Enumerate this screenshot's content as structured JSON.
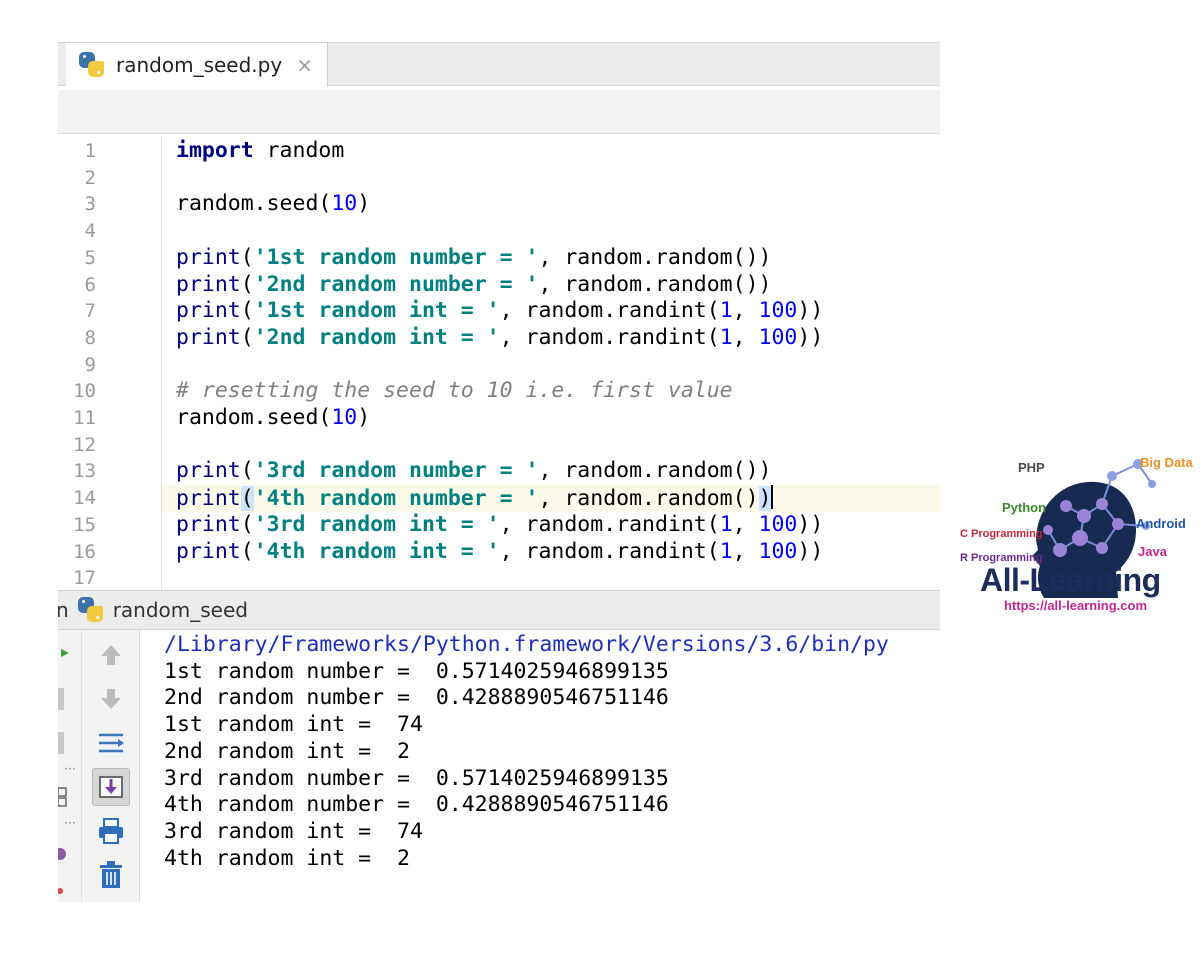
{
  "tab": {
    "filename": "random_seed.py",
    "close_glyph": "×"
  },
  "code_lines": [
    {
      "n": "1",
      "segs": [
        {
          "t": "import",
          "c": "kw"
        },
        {
          "t": " random",
          "c": ""
        }
      ]
    },
    {
      "n": "2",
      "segs": []
    },
    {
      "n": "3",
      "segs": [
        {
          "t": "random.seed(",
          "c": ""
        },
        {
          "t": "10",
          "c": "num"
        },
        {
          "t": ")",
          "c": ""
        }
      ]
    },
    {
      "n": "4",
      "segs": []
    },
    {
      "n": "5",
      "segs": [
        {
          "t": "print",
          "c": "fn"
        },
        {
          "t": "(",
          "c": ""
        },
        {
          "t": "'1st random number = '",
          "c": "str"
        },
        {
          "t": ", random.random())",
          "c": ""
        }
      ]
    },
    {
      "n": "6",
      "segs": [
        {
          "t": "print",
          "c": "fn"
        },
        {
          "t": "(",
          "c": ""
        },
        {
          "t": "'2nd random number = '",
          "c": "str"
        },
        {
          "t": ", random.random())",
          "c": ""
        }
      ]
    },
    {
      "n": "7",
      "segs": [
        {
          "t": "print",
          "c": "fn"
        },
        {
          "t": "(",
          "c": ""
        },
        {
          "t": "'1st random int = '",
          "c": "str"
        },
        {
          "t": ", random.randint(",
          "c": ""
        },
        {
          "t": "1",
          "c": "num"
        },
        {
          "t": ", ",
          "c": ""
        },
        {
          "t": "100",
          "c": "num"
        },
        {
          "t": "))",
          "c": ""
        }
      ]
    },
    {
      "n": "8",
      "segs": [
        {
          "t": "print",
          "c": "fn"
        },
        {
          "t": "(",
          "c": ""
        },
        {
          "t": "'2nd random int = '",
          "c": "str"
        },
        {
          "t": ", random.randint(",
          "c": ""
        },
        {
          "t": "1",
          "c": "num"
        },
        {
          "t": ", ",
          "c": ""
        },
        {
          "t": "100",
          "c": "num"
        },
        {
          "t": "))",
          "c": ""
        }
      ]
    },
    {
      "n": "9",
      "segs": []
    },
    {
      "n": "10",
      "segs": [
        {
          "t": "# resetting the seed to 10 i.e. first value",
          "c": "cm"
        }
      ]
    },
    {
      "n": "11",
      "segs": [
        {
          "t": "random.seed(",
          "c": ""
        },
        {
          "t": "10",
          "c": "num"
        },
        {
          "t": ")",
          "c": ""
        }
      ]
    },
    {
      "n": "12",
      "segs": []
    },
    {
      "n": "13",
      "segs": [
        {
          "t": "print",
          "c": "fn"
        },
        {
          "t": "(",
          "c": ""
        },
        {
          "t": "'3rd random number = '",
          "c": "str"
        },
        {
          "t": ", random.random())",
          "c": ""
        }
      ]
    },
    {
      "n": "14",
      "segs": [
        {
          "t": "print",
          "c": "fn"
        },
        {
          "t": "(",
          "c": "brace"
        },
        {
          "t": "'4th random number = '",
          "c": "str"
        },
        {
          "t": ", random.random()",
          "c": ""
        },
        {
          "t": ")",
          "c": "brace"
        }
      ],
      "current": true
    },
    {
      "n": "15",
      "segs": [
        {
          "t": "print",
          "c": "fn"
        },
        {
          "t": "(",
          "c": ""
        },
        {
          "t": "'3rd random int = '",
          "c": "str"
        },
        {
          "t": ", random.randint(",
          "c": ""
        },
        {
          "t": "1",
          "c": "num"
        },
        {
          "t": ", ",
          "c": ""
        },
        {
          "t": "100",
          "c": "num"
        },
        {
          "t": "))",
          "c": ""
        }
      ]
    },
    {
      "n": "16",
      "segs": [
        {
          "t": "print",
          "c": "fn"
        },
        {
          "t": "(",
          "c": ""
        },
        {
          "t": "'4th random int = '",
          "c": "str"
        },
        {
          "t": ", random.randint(",
          "c": ""
        },
        {
          "t": "1",
          "c": "num"
        },
        {
          "t": ", ",
          "c": ""
        },
        {
          "t": "100",
          "c": "num"
        },
        {
          "t": "))",
          "c": ""
        }
      ]
    },
    {
      "n": "17",
      "segs": []
    }
  ],
  "run": {
    "prefix": "n",
    "title": "random_seed",
    "output_path": "/Library/Frameworks/Python.framework/Versions/3.6/bin/py",
    "output_lines": [
      "1st random number =  0.5714025946899135",
      "2nd random number =  0.4288890546751146",
      "1st random int =  74",
      "2nd random int =  2",
      "3rd random number =  0.5714025946899135",
      "4th random number =  0.4288890546751146",
      "3rd random int =  74",
      "4th random int =  2"
    ]
  },
  "logo": {
    "name": "All-Learning",
    "url": "https://all-learning.com",
    "tags": [
      {
        "label": "PHP",
        "color": "#4a4a4a"
      },
      {
        "label": "Big Data",
        "color": "#e8922a"
      },
      {
        "label": "Python",
        "color": "#3a8a2e"
      },
      {
        "label": "Android",
        "color": "#1f56a8"
      },
      {
        "label": "C Programming",
        "color": "#c0273a"
      },
      {
        "label": "Java",
        "color": "#c2278f"
      },
      {
        "label": "R Programming",
        "color": "#6b2a8f"
      }
    ]
  },
  "colors": {
    "keyword": "#000080",
    "string": "#008080",
    "number": "#0000ff",
    "comment": "#808080",
    "path": "#1f2fb5"
  }
}
